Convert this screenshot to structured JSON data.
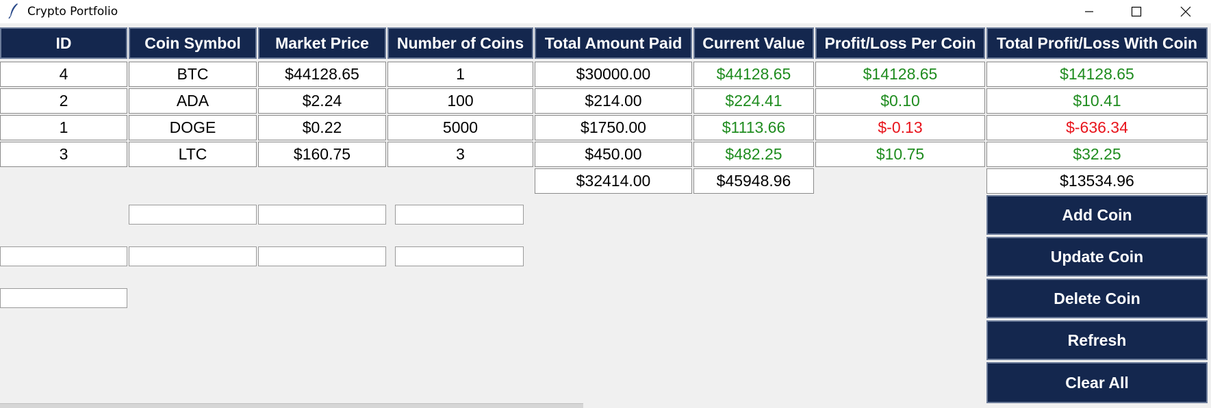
{
  "window": {
    "title": "Crypto Portfolio"
  },
  "table": {
    "headers": [
      "ID",
      "Coin Symbol",
      "Market Price",
      "Number of Coins",
      "Total Amount Paid",
      "Current Value",
      "Profit/Loss Per Coin",
      "Total Profit/Loss With Coin"
    ],
    "rows": [
      [
        "4",
        "BTC",
        "$44128.65",
        "1",
        "$30000.00",
        "$44128.65",
        "$14128.65",
        "$14128.65"
      ],
      [
        "2",
        "ADA",
        "$2.24",
        "100",
        "$214.00",
        "$224.41",
        "$0.10",
        "$10.41"
      ],
      [
        "1",
        "DOGE",
        "$0.22",
        "5000",
        "$1750.00",
        "$1113.66",
        "$-0.13",
        "$-636.34"
      ],
      [
        "3",
        "LTC",
        "$160.75",
        "3",
        "$450.00",
        "$482.25",
        "$10.75",
        "$32.25"
      ]
    ],
    "totals": {
      "amount_paid": "$32414.00",
      "current_value": "$45948.96",
      "profit_loss": "$13534.96"
    }
  },
  "buttons": {
    "add": "Add Coin",
    "update": "Update Coin",
    "delete": "Delete Coin",
    "refresh": "Refresh",
    "clear": "Clear All"
  },
  "inputs": {
    "add_symbol": "",
    "add_price": "",
    "add_amount": "",
    "update_id": "",
    "update_symbol": "",
    "update_price": "",
    "update_amount": "",
    "delete_id": ""
  },
  "colors": {
    "header_bg": "#14274e",
    "profit": "#1f8c1f",
    "loss": "#e8141c",
    "background": "#f0f0f0"
  }
}
